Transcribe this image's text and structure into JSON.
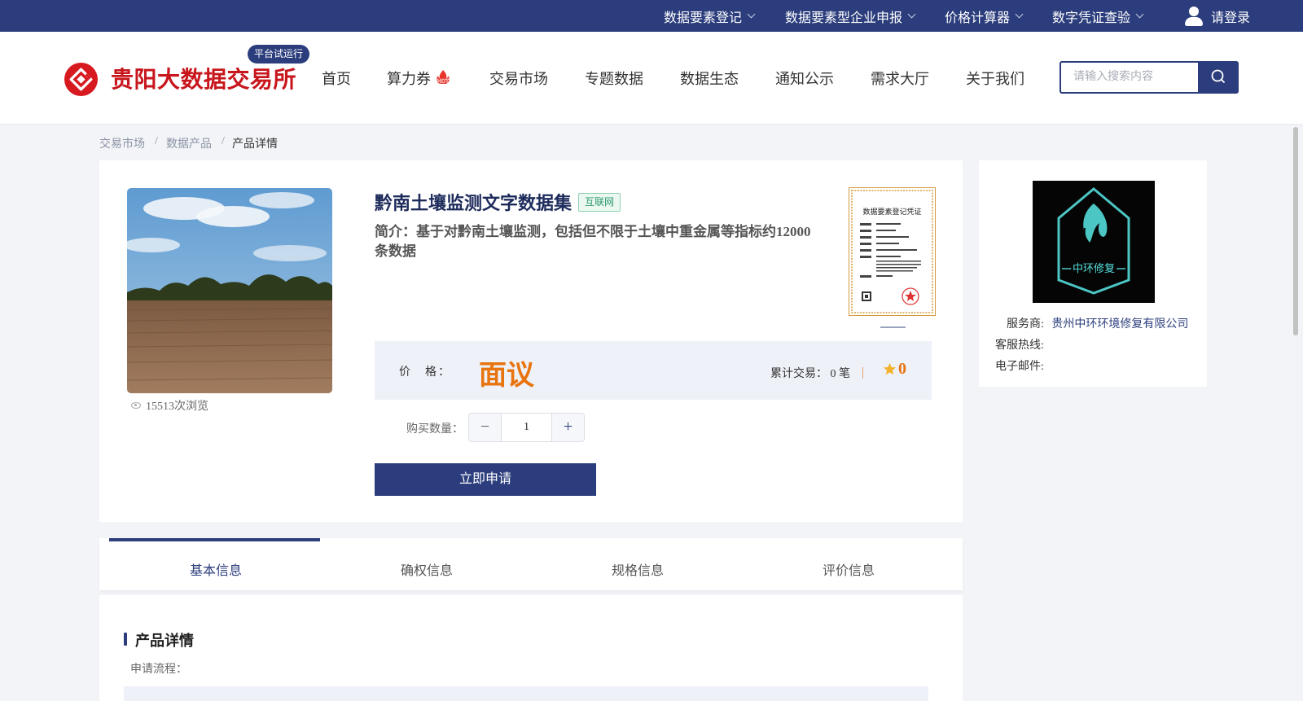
{
  "topbar": {
    "items": [
      {
        "label": "数据要素登记"
      },
      {
        "label": "数据要素型企业申报"
      },
      {
        "label": "价格计算器"
      },
      {
        "label": "数字凭证查验"
      }
    ],
    "login_label": "请登录"
  },
  "header": {
    "logo_text": "贵阳大数据交易所",
    "badge": "平台试运行",
    "nav": [
      {
        "label": "首页"
      },
      {
        "label": "算力券"
      },
      {
        "label": "交易市场"
      },
      {
        "label": "专题数据"
      },
      {
        "label": "数据生态"
      },
      {
        "label": "通知公示"
      },
      {
        "label": "需求大厅"
      },
      {
        "label": "关于我们"
      }
    ],
    "hot_badge": "HOT",
    "search_placeholder": "请输入搜索内容"
  },
  "breadcrumb": {
    "items": [
      "交易市场",
      "数据产品",
      "产品详情"
    ],
    "separator": "/"
  },
  "product": {
    "title": "黔南土壤监测文字数据集",
    "tag": "互联网",
    "description": "简介：基于对黔南土壤监测，包括但不限于土壤中重金属等指标约12000条数据",
    "views": "15513次浏览",
    "cert_title": "数据要素登记凭证",
    "price_label": "价　格：",
    "price_value": "面议",
    "trade_label": "累计交易：",
    "trade_count": "0",
    "trade_unit": "笔",
    "rating": "0",
    "quantity_label": "购买数量：",
    "quantity": "1",
    "apply_label": "立即申请"
  },
  "provider": {
    "logo_text": "中环修复",
    "service_label": "服务商:",
    "service_name": "贵州中环环境修复有限公司",
    "hotline_label": "客服热线:",
    "email_label": "电子邮件:"
  },
  "tabs": [
    {
      "label": "基本信息"
    },
    {
      "label": "确权信息"
    },
    {
      "label": "规格信息"
    },
    {
      "label": "评价信息"
    }
  ],
  "detail": {
    "section_title": "产品详情",
    "subtitle": "申请流程："
  },
  "colors": {
    "brand": "#2b3d7c",
    "logo_red": "#c8161d",
    "price_orange": "#e8740f",
    "tag_green": "#2c9a6d"
  }
}
